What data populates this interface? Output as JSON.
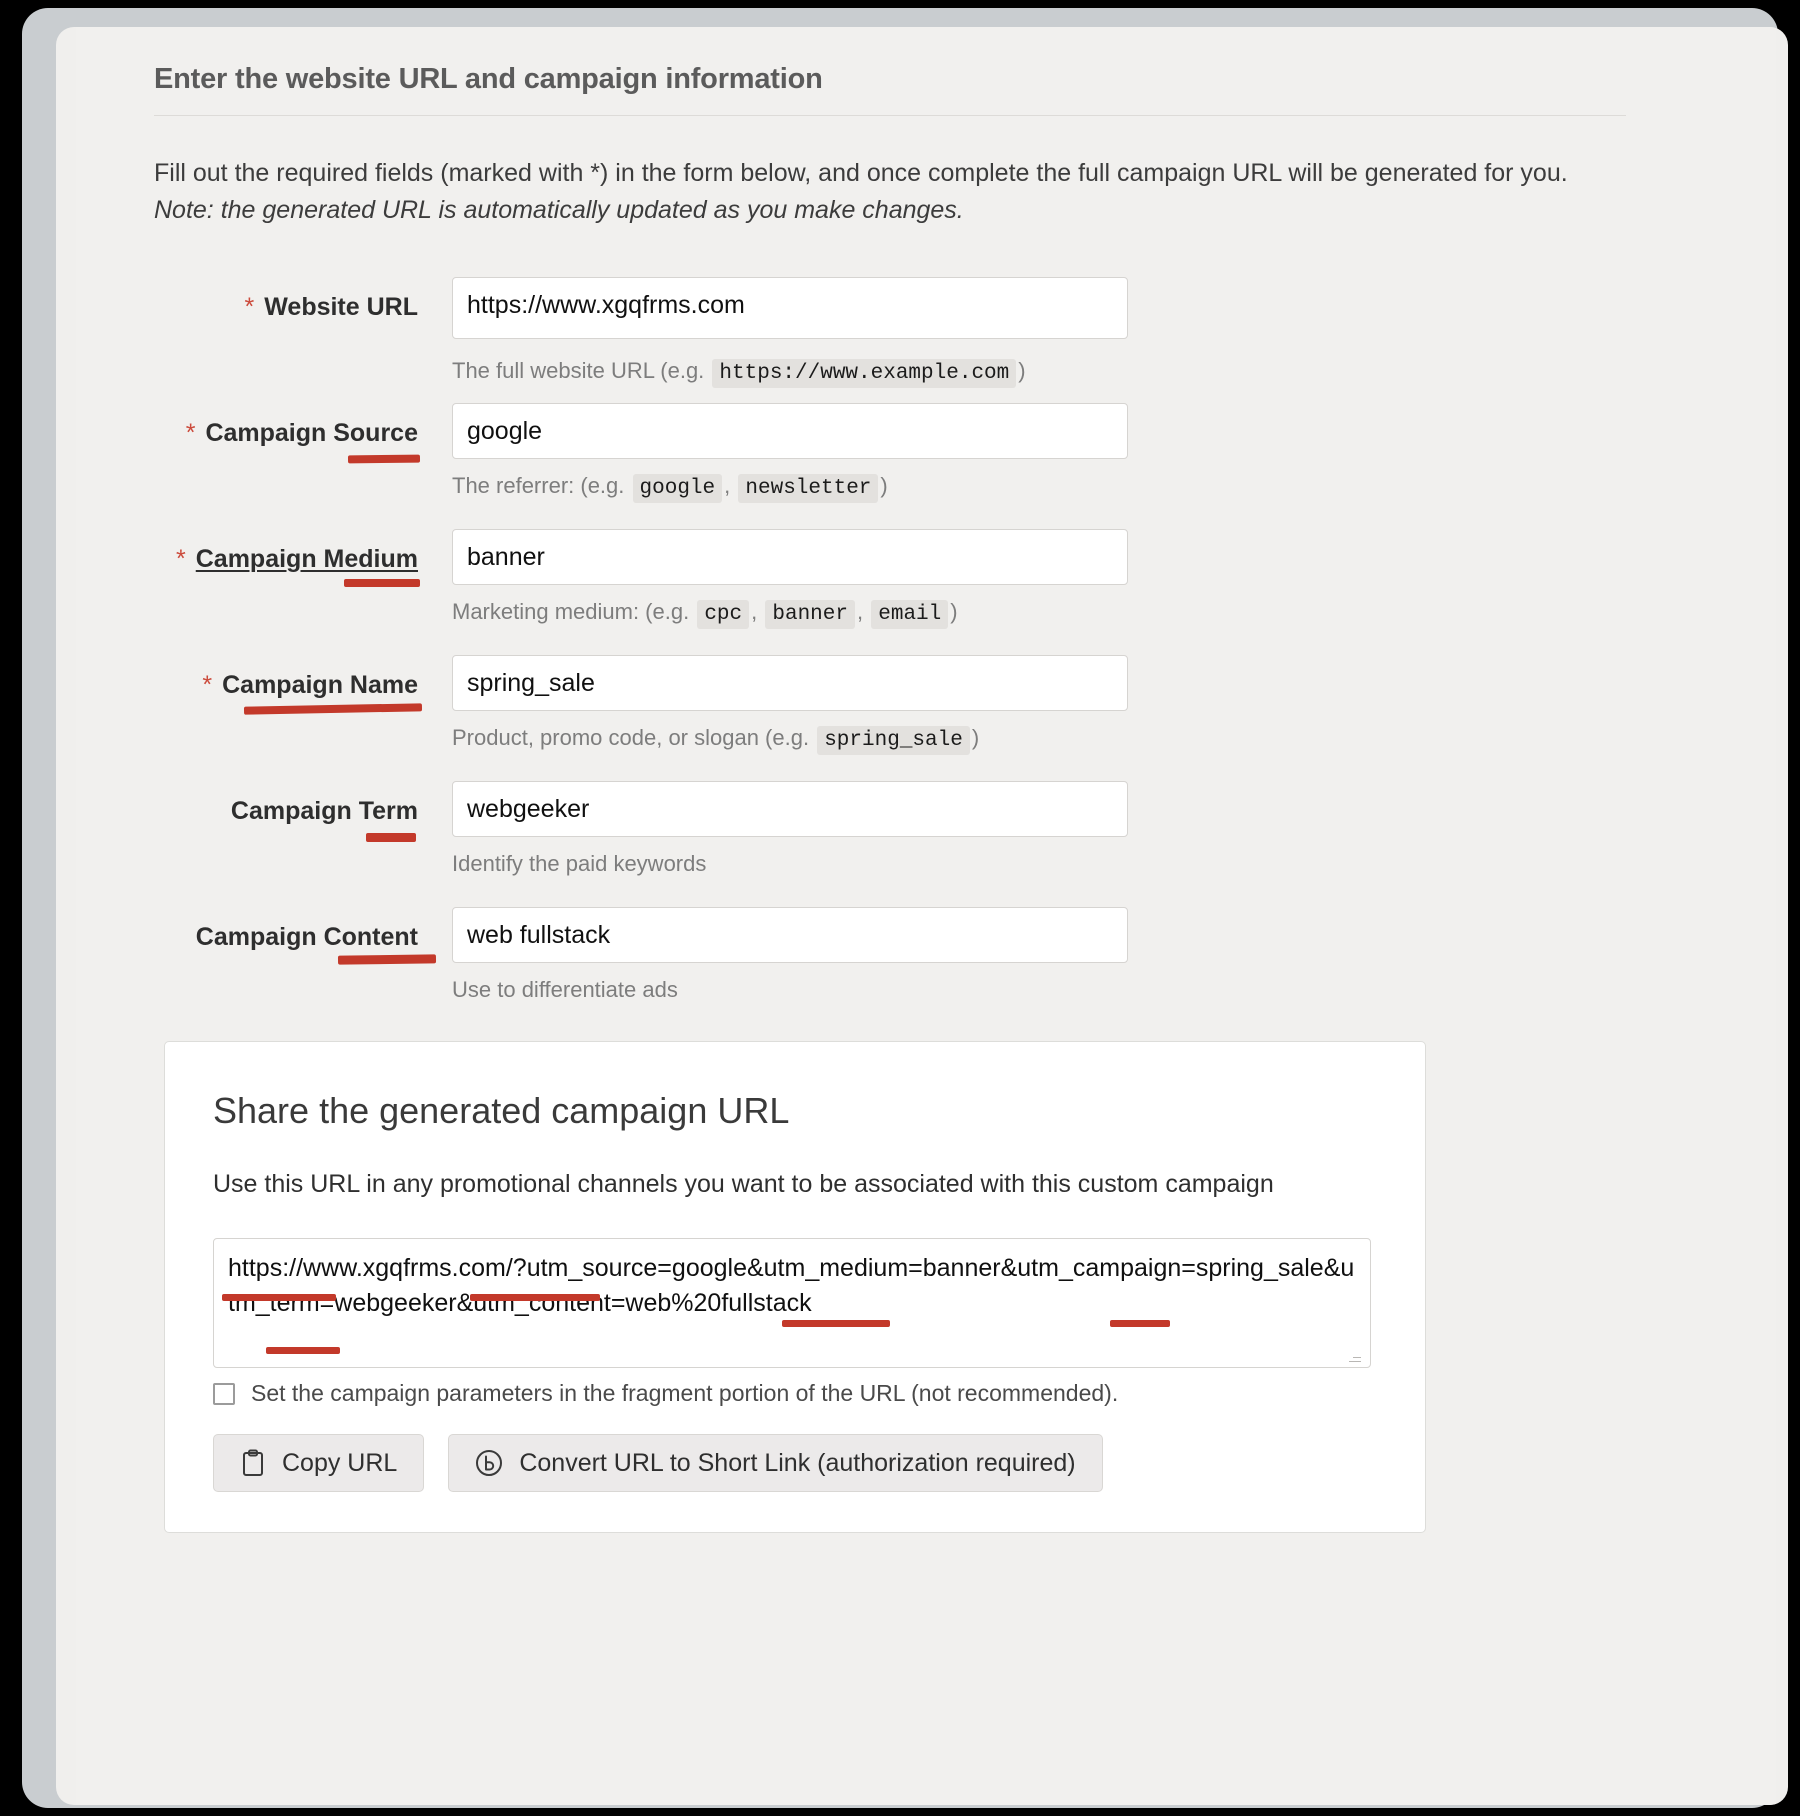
{
  "panel": {
    "title": "Enter the website URL and campaign information",
    "intro_main": "Fill out the required fields (marked with *) in the form below, and once complete the full campaign URL will be generated for you. ",
    "intro_note": "Note: the generated URL is automatically updated as you make changes."
  },
  "form": {
    "required_marker": "*",
    "fields": [
      {
        "label": "Website URL",
        "required": true,
        "value": "https://www.xgqfrms.com",
        "hint_prefix": "The full website URL (e.g. ",
        "hint_codes": [
          "https://www.example.com"
        ],
        "hint_suffix": ")"
      },
      {
        "label": "Campaign Source",
        "required": true,
        "value": "google",
        "hint_prefix": "The referrer: (e.g. ",
        "hint_codes": [
          "google",
          "newsletter"
        ],
        "hint_suffix": ")"
      },
      {
        "label": "Campaign Medium",
        "required": true,
        "value": "banner",
        "hint_prefix": "Marketing medium: (e.g. ",
        "hint_codes": [
          "cpc",
          "banner",
          "email"
        ],
        "hint_suffix": ")"
      },
      {
        "label": "Campaign Name",
        "required": true,
        "value": "spring_sale",
        "hint_prefix": "Product, promo code, or slogan (e.g. ",
        "hint_codes": [
          "spring_sale"
        ],
        "hint_suffix": ")"
      },
      {
        "label": "Campaign Term",
        "required": false,
        "value": "webgeeker",
        "hint_prefix": "Identify the paid keywords",
        "hint_codes": [],
        "hint_suffix": ""
      },
      {
        "label": "Campaign Content",
        "required": false,
        "value": "web fullstack",
        "hint_prefix": "Use to differentiate ads",
        "hint_codes": [],
        "hint_suffix": ""
      }
    ]
  },
  "share": {
    "title": "Share the generated campaign URL",
    "description": "Use this URL in any promotional channels you want to be associated with this custom campaign",
    "generated_url": "https://www.xgqfrms.com/?utm_source=google&utm_medium=banner&utm_campaign=spring_sale&utm_term=webgeeker&utm_content=web%20fullstack",
    "fragment_checkbox_label": "Set the campaign parameters in the fragment portion of the URL (not recommended).",
    "fragment_checked": false,
    "copy_button_label": "Copy URL",
    "shortlink_button_label": "Convert URL to Short Link (authorization required)"
  },
  "annotations": {
    "color": "#c3392a",
    "marked_terms": [
      "Campaign Source",
      "Campaign Medium",
      "Campaign Name",
      "Campaign Term",
      "Campaign Content",
      "utm_source",
      "utm_medium",
      "utm_campaign",
      "utm_term",
      "utm_content"
    ]
  }
}
